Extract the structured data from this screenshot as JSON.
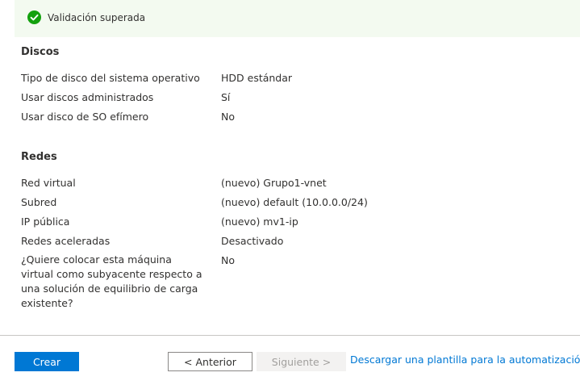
{
  "validation": {
    "message": "Validación superada",
    "status_color": "#13a10e",
    "icon": "check-circle-icon"
  },
  "discos": {
    "title": "Discos",
    "rows": [
      {
        "label": "Tipo de disco del sistema operativo",
        "value": "HDD estándar"
      },
      {
        "label": "Usar discos administrados",
        "value": "Sí"
      },
      {
        "label": "Usar disco de SO efímero",
        "value": "No"
      }
    ]
  },
  "redes": {
    "title": "Redes",
    "rows": [
      {
        "label": "Red virtual",
        "value": "(nuevo) Grupo1-vnet"
      },
      {
        "label": "Subred",
        "value": "(nuevo) default (10.0.0.0/24)"
      },
      {
        "label": "IP pública",
        "value": "(nuevo) mv1-ip"
      },
      {
        "label": "Redes aceleradas",
        "value": "Desactivado"
      },
      {
        "label": "¿Quiere colocar esta máquina virtual como subyacente respecto a una solución de equilibrio de carga existente?",
        "value": "No"
      }
    ]
  },
  "footer": {
    "create_label": "Crear",
    "previous_label": "< Anterior",
    "next_label": "Siguiente >",
    "download_link": "Descargar una plantilla para la automatización",
    "accent_color": "#0078d4"
  }
}
